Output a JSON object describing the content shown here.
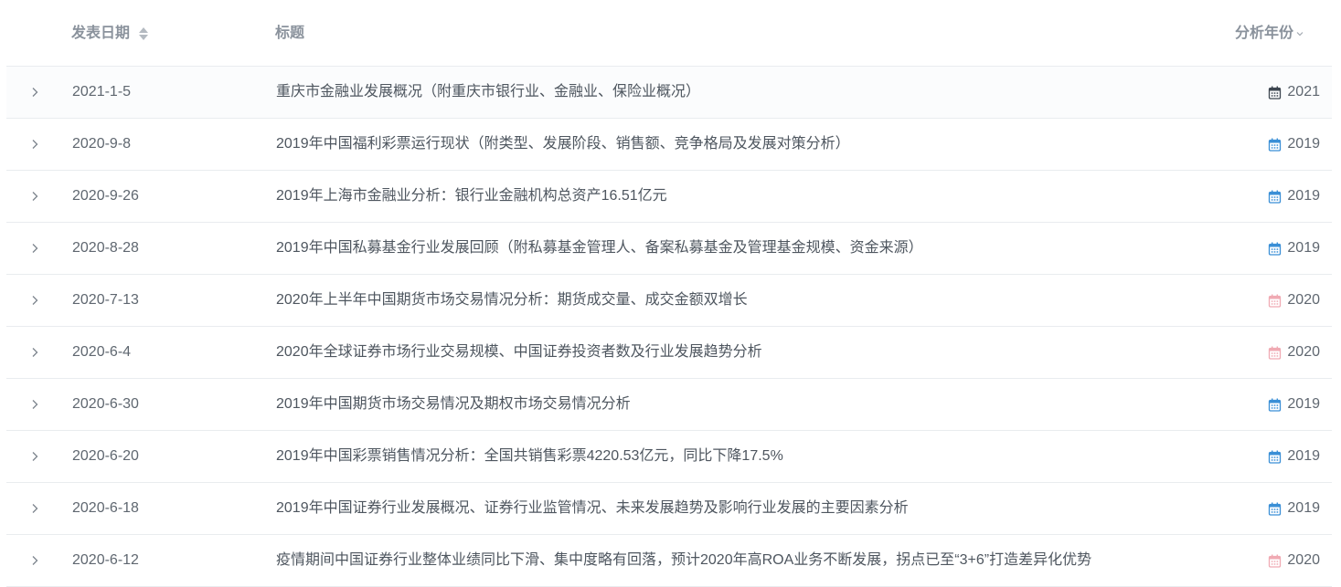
{
  "header": {
    "date_label": "发表日期",
    "title_label": "标题",
    "year_label": "分析年份"
  },
  "rows": [
    {
      "date": "2021-1-5",
      "title": "重庆市金融业发展概况（附重庆市银行业、金融业、保险业概况）",
      "year": "2021",
      "year_color": "#3d4650"
    },
    {
      "date": "2020-9-8",
      "title": "2019年中国福利彩票运行现状（附类型、发展阶段、销售额、竞争格局及发展对策分析）",
      "year": "2019",
      "year_color": "#3a8fd6"
    },
    {
      "date": "2020-9-26",
      "title": "2019年上海市金融业分析：银行业金融机构总资产16.51亿元",
      "year": "2019",
      "year_color": "#3a8fd6"
    },
    {
      "date": "2020-8-28",
      "title": "2019年中国私募基金行业发展回顾（附私募基金管理人、备案私募基金及管理基金规模、资金来源）",
      "year": "2019",
      "year_color": "#3a8fd6"
    },
    {
      "date": "2020-7-13",
      "title": "2020年上半年中国期货市场交易情况分析：期货成交量、成交金额双增长",
      "year": "2020",
      "year_color": "#f0aab3"
    },
    {
      "date": "2020-6-4",
      "title": "2020年全球证券市场行业交易规模、中国证券投资者数及行业发展趋势分析",
      "year": "2020",
      "year_color": "#f0aab3"
    },
    {
      "date": "2020-6-30",
      "title": "2019年中国期货市场交易情况及期权市场交易情况分析",
      "year": "2019",
      "year_color": "#3a8fd6"
    },
    {
      "date": "2020-6-20",
      "title": "2019年中国彩票销售情况分析：全国共销售彩票4220.53亿元，同比下降17.5%",
      "year": "2019",
      "year_color": "#3a8fd6"
    },
    {
      "date": "2020-6-18",
      "title": "2019年中国证券行业发展概况、证券行业监管情况、未来发展趋势及影响行业发展的主要因素分析",
      "year": "2019",
      "year_color": "#3a8fd6"
    },
    {
      "date": "2020-6-12",
      "title": "疫情期间中国证券行业整体业绩同比下滑、集中度略有回落，预计2020年高ROA业务不断发展，拐点已至“3+6”打造差异化优势",
      "year": "2020",
      "year_color": "#f0aab3"
    }
  ]
}
